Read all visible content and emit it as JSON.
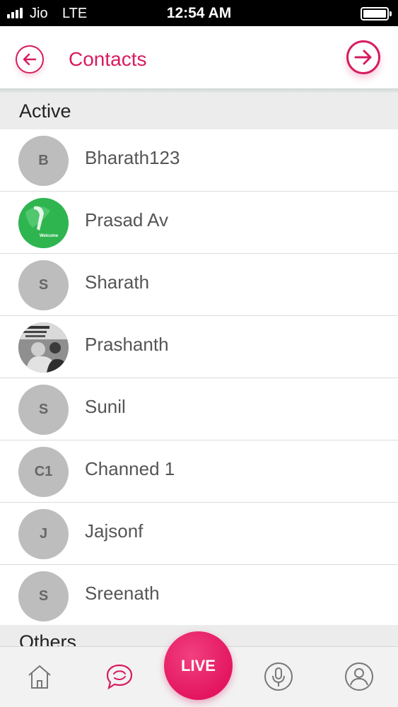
{
  "status_bar": {
    "carrier": "Jio",
    "network": "LTE",
    "time": "12:54 AM",
    "signal_bars": 4,
    "battery_level": 1.0
  },
  "header": {
    "title": "Contacts",
    "back_icon": "arrow-left-circle-icon",
    "forward_icon": "arrow-right-circle-icon",
    "accent_color": "#d81b60"
  },
  "sections": {
    "active": "Active",
    "others": "Others"
  },
  "contacts": [
    {
      "initials": "B",
      "name": "Bharath123",
      "avatar": "initials"
    },
    {
      "initials": "",
      "name": "Prasad Av",
      "avatar": "image",
      "image_text": "Welcome"
    },
    {
      "initials": "S",
      "name": "Sharath",
      "avatar": "initials"
    },
    {
      "initials": "",
      "name": "Prashanth",
      "avatar": "image"
    },
    {
      "initials": "S",
      "name": "Sunil",
      "avatar": "initials"
    },
    {
      "initials": "C1",
      "name": "Channed 1",
      "avatar": "initials"
    },
    {
      "initials": "J",
      "name": "Jajsonf",
      "avatar": "initials"
    },
    {
      "initials": "S",
      "name": "Sreenath",
      "avatar": "initials"
    }
  ],
  "bottom_nav": {
    "live_label": "LIVE",
    "items": [
      {
        "icon": "home-icon"
      },
      {
        "icon": "chat-icon"
      },
      {
        "icon": "microphone-icon"
      },
      {
        "icon": "profile-icon"
      }
    ]
  }
}
